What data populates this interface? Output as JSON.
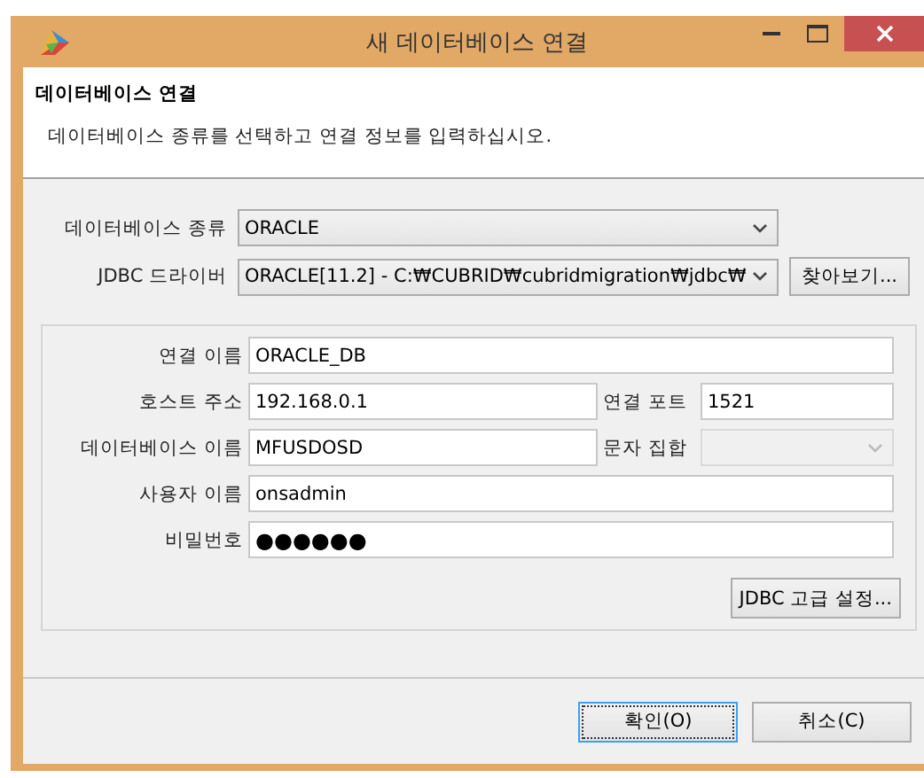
{
  "window": {
    "title": "새 데이터베이스 연결"
  },
  "header": {
    "title": "데이터베이스 연결",
    "description": "데이터베이스 종류를 선택하고 연결 정보를 입력하십시오."
  },
  "database_type": {
    "label": "데이터베이스 종류",
    "value": "ORACLE"
  },
  "jdbc_driver": {
    "label": "JDBC 드라이버",
    "value": "ORACLE[11.2] - C:₩CUBRID₩cubridmigration₩jdbc₩",
    "browse_button": "찾아보기..."
  },
  "connection_name": {
    "label": "연결 이름",
    "value": "ORACLE_DB"
  },
  "host": {
    "label": "호스트 주소",
    "value": "192.168.0.1"
  },
  "port": {
    "label": "연결 포트",
    "value": "1521"
  },
  "database_name": {
    "label": "데이터베이스 이름",
    "value": "MFUSDOSD"
  },
  "charset": {
    "label": "문자 집합",
    "disabled": true
  },
  "user_name": {
    "label": "사용자 이름",
    "value": "onsadmin"
  },
  "password": {
    "label": "비밀번호",
    "value": "●●●●●●"
  },
  "advanced_button": "JDBC 고급 설정...",
  "buttons": [
    {
      "label": "확인(O)",
      "selected": true
    },
    {
      "label": "취소(C)",
      "selected": false
    }
  ]
}
